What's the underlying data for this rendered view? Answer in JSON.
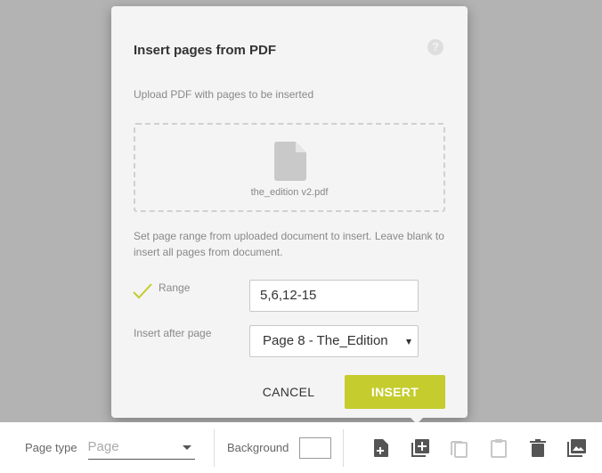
{
  "dialog": {
    "title": "Insert pages from PDF",
    "help_icon": "help-circle-icon",
    "upload_label": "Upload PDF with pages to be inserted",
    "file_icon": "document-icon",
    "file_name": "the_edition v2.pdf",
    "range_description": "Set page range from uploaded document to insert. Leave blank to insert all pages from document.",
    "range_check_icon": "checkmark-icon",
    "range_label": "Range",
    "range_value": "5,6,12-15",
    "insert_after_label": "Insert after page",
    "insert_after_value": "Page 8 - The_Edition",
    "cancel_label": "CANCEL",
    "insert_label": "INSERT"
  },
  "toolbar": {
    "page_type_label": "Page type",
    "page_type_placeholder": "Page",
    "background_label": "Background",
    "icons": [
      "add-page-icon",
      "insert-pages-icon",
      "copy-icon",
      "paste-icon",
      "delete-icon",
      "image-icon"
    ]
  },
  "colors": {
    "accent": "#c5cc2e",
    "backdrop": "#b3b3b3",
    "dialog_bg": "#f4f4f4"
  }
}
